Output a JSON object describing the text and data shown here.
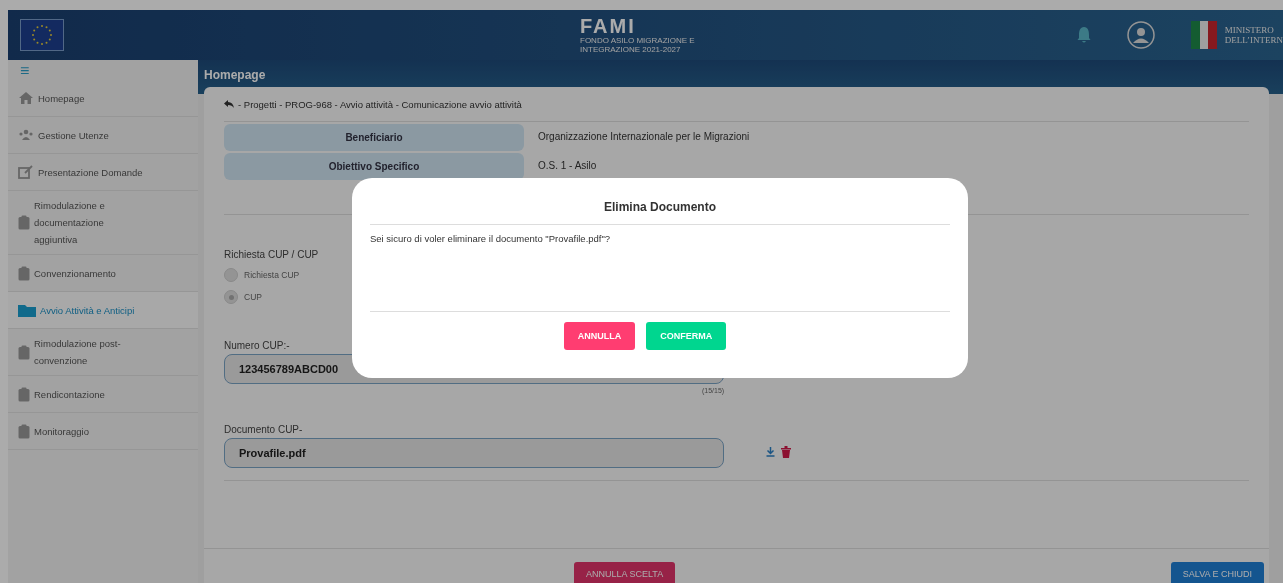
{
  "header": {
    "logo_title": "FAMI",
    "logo_subtitle": [
      "FONDO ASILO MIGRAZIONE E",
      "INTEGRAZIONE 2021-2027"
    ],
    "ministry": [
      "MINISTERO",
      "DELL’INTERN"
    ]
  },
  "sidebar": {
    "menu_glyph": "≡",
    "items": [
      {
        "kind": "home",
        "label": "Homepage",
        "selected": false
      },
      {
        "kind": "users",
        "label": "Gestione Utenze",
        "selected": false
      },
      {
        "kind": "edit",
        "label": "Presentazione Domande",
        "selected": false
      },
      {
        "kind": "clipboard",
        "label": "Rimodulazione e documentazione aggiuntiva",
        "selected": false
      },
      {
        "kind": "clipboard",
        "label": "Convenzionamento",
        "selected": false
      },
      {
        "kind": "folder",
        "label": "Avvio Attività e Anticipi",
        "selected": true
      },
      {
        "kind": "clipboard",
        "label": "Rimodulazione post-convenzione",
        "selected": false
      },
      {
        "kind": "clipboard",
        "label": "Rendicontazione",
        "selected": false
      },
      {
        "kind": "clipboard",
        "label": "Monitoraggio",
        "selected": false
      }
    ]
  },
  "page_title": "Homepage",
  "breadcrumb": "- Progetti - PROG-968 - Avvio attività - Comunicazione avvio attività",
  "info_rows": [
    {
      "label": "Beneficiario",
      "value": "Organizzazione Internazionale per le Migrazioni"
    },
    {
      "label": "Obiettivo Specifico",
      "value": "O.S. 1 - Asilo"
    }
  ],
  "cup_choice": {
    "label": "Richiesta CUP / CUP",
    "options": [
      {
        "label": "Richiesta CUP",
        "selected": false
      },
      {
        "label": "CUP",
        "selected": true
      }
    ]
  },
  "numero_cup": {
    "label": "Numero CUP:-",
    "value": "123456789ABCD00",
    "counter": "(15/15)"
  },
  "documento_cup": {
    "label": "Documento CUP-",
    "value": "Provafile.pdf"
  },
  "footer_buttons": [
    {
      "kind": "danger",
      "label": "ANNULLA SCELTA"
    },
    {
      "kind": "primary",
      "label": "SALVA E CHIUDI"
    }
  ],
  "dialog": {
    "title": "Elimina Documento",
    "message": "Sei sicuro di voler eliminare il documento \"Provafile.pdf\"?",
    "buttons": [
      {
        "kind": "danger",
        "label": "ANNULLA"
      },
      {
        "kind": "confirm",
        "label": "CONFERMA"
      }
    ]
  }
}
